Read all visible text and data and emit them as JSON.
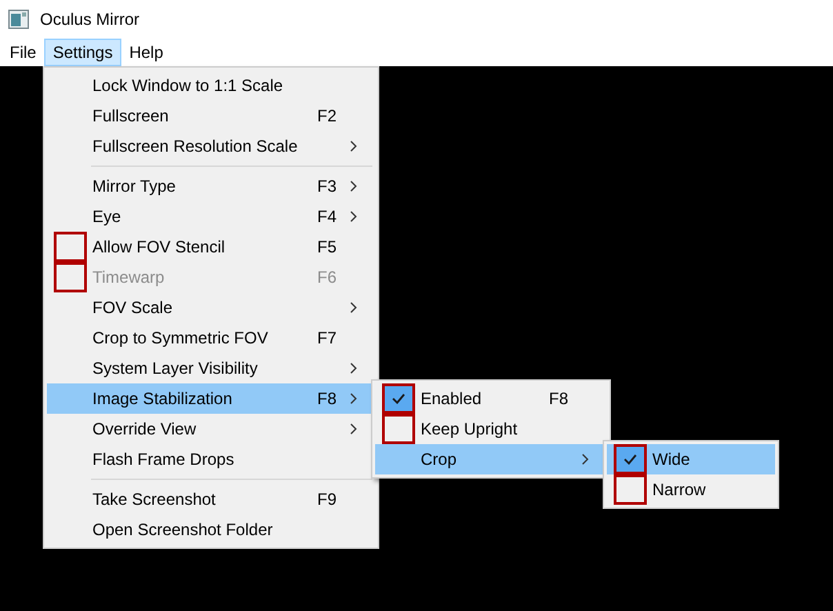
{
  "window": {
    "title": "Oculus Mirror"
  },
  "menubar": [
    {
      "label": "File",
      "selected": false
    },
    {
      "label": "Settings",
      "selected": true
    },
    {
      "label": "Help",
      "selected": false
    }
  ],
  "settings_menu": [
    {
      "kind": "command",
      "label": "Lock Window to 1:1 Scale",
      "disabled": false,
      "selected": false
    },
    {
      "kind": "command",
      "label": "Fullscreen",
      "shortcut": "F2",
      "disabled": false,
      "selected": false
    },
    {
      "kind": "command",
      "label": "Fullscreen Resolution Scale",
      "submenu": true,
      "disabled": false,
      "selected": false
    },
    {
      "kind": "separator"
    },
    {
      "kind": "command",
      "label": "Mirror Type",
      "shortcut": "F3",
      "submenu": true,
      "disabled": false,
      "selected": false
    },
    {
      "kind": "command",
      "label": "Eye",
      "shortcut": "F4",
      "submenu": true,
      "disabled": false,
      "selected": false
    },
    {
      "kind": "checkbox",
      "label": "Allow FOV Stencil",
      "shortcut": "F5",
      "checked": false,
      "disabled": false,
      "selected": false
    },
    {
      "kind": "checkbox",
      "label": "Timewarp",
      "shortcut": "F6",
      "checked": false,
      "disabled": true,
      "selected": false
    },
    {
      "kind": "command",
      "label": "FOV Scale",
      "submenu": true,
      "disabled": false,
      "selected": false
    },
    {
      "kind": "command",
      "label": "Crop to Symmetric FOV",
      "shortcut": "F7",
      "disabled": false,
      "selected": false
    },
    {
      "kind": "command",
      "label": "System Layer Visibility",
      "submenu": true,
      "disabled": false,
      "selected": false
    },
    {
      "kind": "command",
      "label": "Image Stabilization",
      "shortcut": "F8",
      "submenu": true,
      "disabled": false,
      "selected": true,
      "children": [
        {
          "kind": "checkbox",
          "label": "Enabled",
          "shortcut": "F8",
          "checked": true,
          "disabled": false,
          "selected": false
        },
        {
          "kind": "checkbox",
          "label": "Keep Upright",
          "checked": false,
          "disabled": false,
          "selected": false
        },
        {
          "kind": "command",
          "label": "Crop",
          "submenu": true,
          "disabled": false,
          "selected": true,
          "children": [
            {
              "kind": "checkbox",
              "label": "Wide",
              "checked": true,
              "disabled": false,
              "selected": true
            },
            {
              "kind": "checkbox",
              "label": "Narrow",
              "checked": false,
              "disabled": false,
              "selected": false
            }
          ]
        }
      ]
    },
    {
      "kind": "command",
      "label": "Override View",
      "submenu": true,
      "disabled": false,
      "selected": false
    },
    {
      "kind": "command",
      "label": "Flash Frame Drops",
      "disabled": false,
      "selected": false
    },
    {
      "kind": "separator"
    },
    {
      "kind": "command",
      "label": "Take Screenshot",
      "shortcut": "F9",
      "disabled": false,
      "selected": false
    },
    {
      "kind": "command",
      "label": "Open Screenshot Folder",
      "disabled": false,
      "selected": false
    }
  ]
}
